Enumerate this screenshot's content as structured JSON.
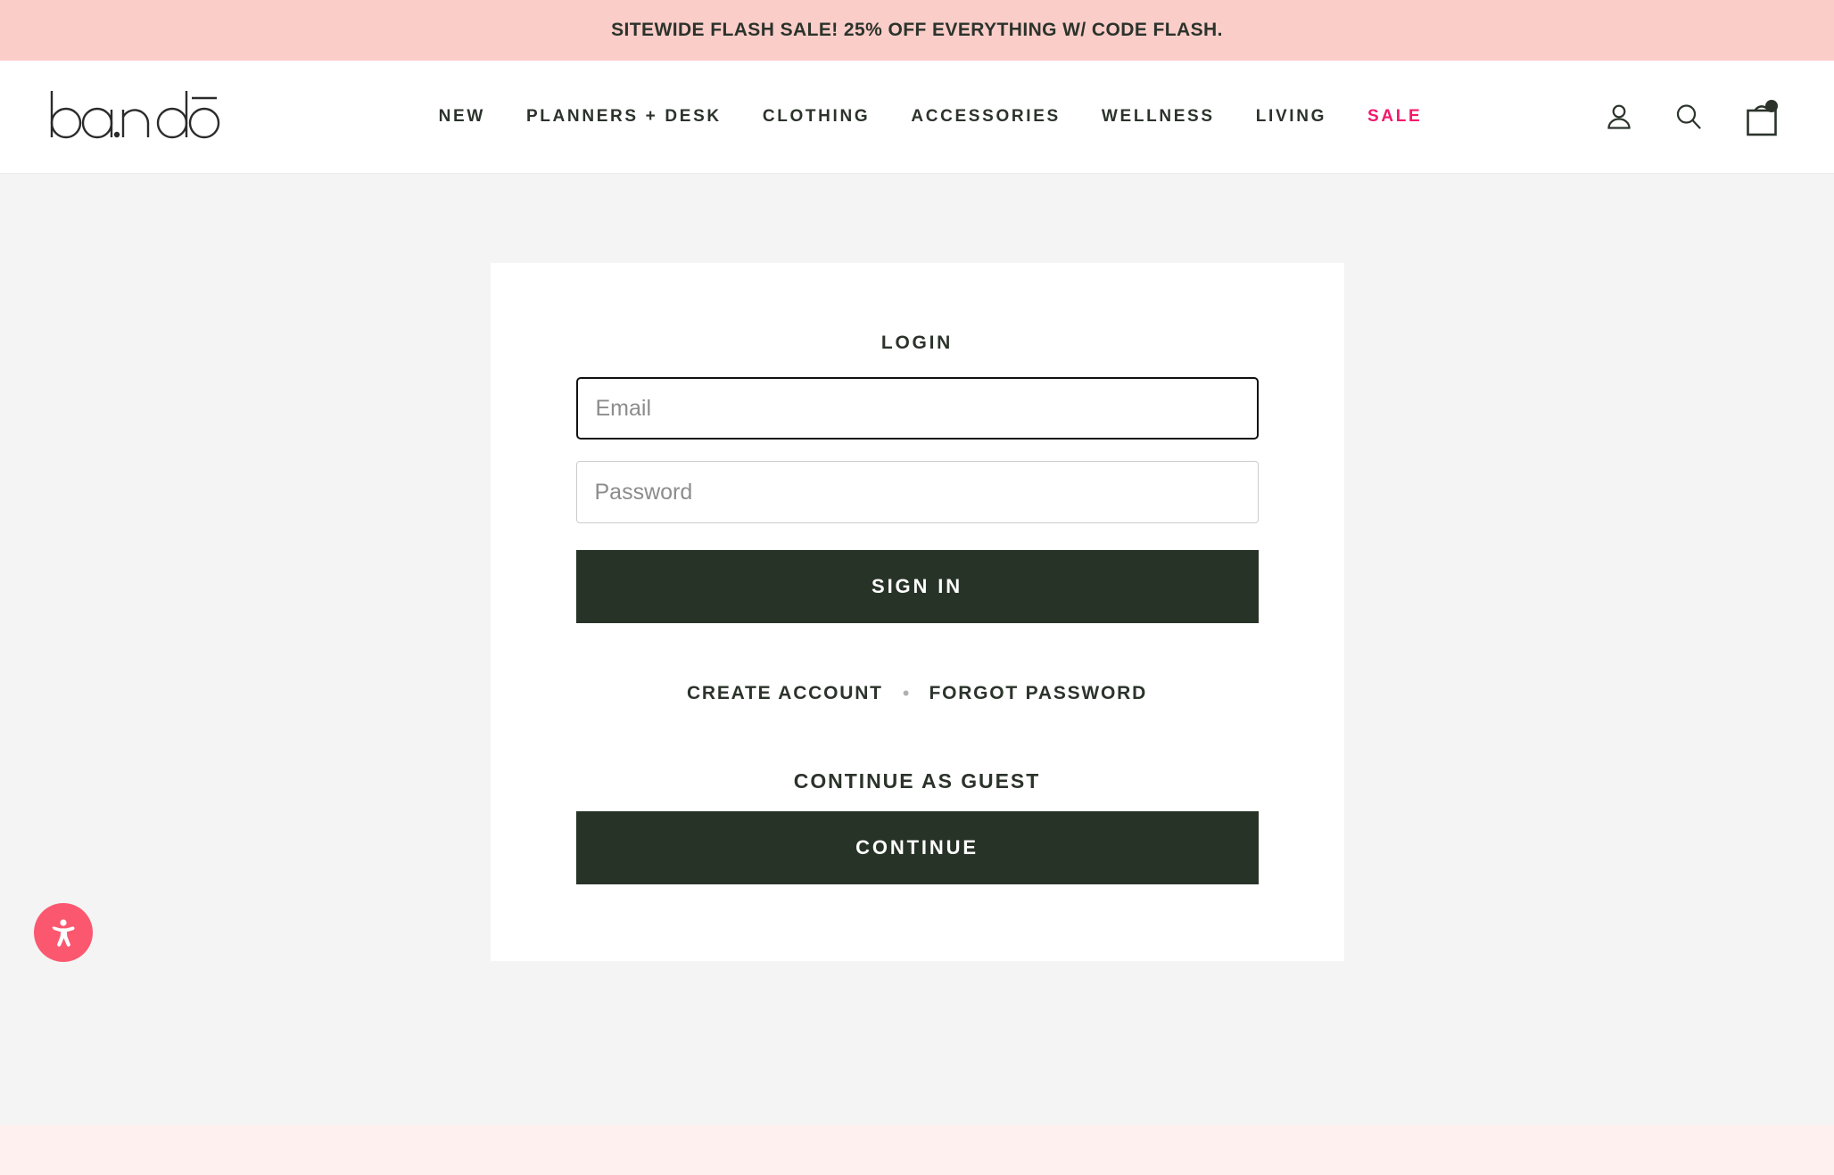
{
  "promo": {
    "text": "SITEWIDE FLASH SALE! 25% OFF EVERYTHING W/ CODE FLASH.",
    "bg_color": "#fbcdc9"
  },
  "header": {
    "logo_text": "ban.dō",
    "nav": [
      {
        "label": "NEW",
        "accent": false
      },
      {
        "label": "PLANNERS + DESK",
        "accent": false
      },
      {
        "label": "CLOTHING",
        "accent": false
      },
      {
        "label": "ACCESSORIES",
        "accent": false
      },
      {
        "label": "WELLNESS",
        "accent": false
      },
      {
        "label": "LIVING",
        "accent": false
      },
      {
        "label": "SALE",
        "accent": true
      }
    ],
    "sale_color": "#f4186c",
    "icons": {
      "account": "account-icon",
      "search": "search-icon",
      "cart": "cart-icon",
      "cart_has_badge": true
    }
  },
  "login_card": {
    "title": "LOGIN",
    "email": {
      "placeholder": "Email",
      "value": "",
      "focused": true
    },
    "password": {
      "placeholder": "Password",
      "value": "",
      "focused": false
    },
    "sign_in_label": "SIGN IN",
    "create_account_label": "CREATE ACCOUNT",
    "separator": "•",
    "forgot_password_label": "FORGOT PASSWORD",
    "guest_title": "CONTINUE AS GUEST",
    "continue_label": "CONTINUE",
    "button_color": "#283328"
  },
  "accessibility": {
    "name": "accessibility-widget",
    "color": "#fb5870"
  },
  "colors": {
    "page_background": "#f4f4f4",
    "card_background": "#ffffff",
    "text": "#2b332b",
    "footer_strip": "#fdf0ef"
  }
}
